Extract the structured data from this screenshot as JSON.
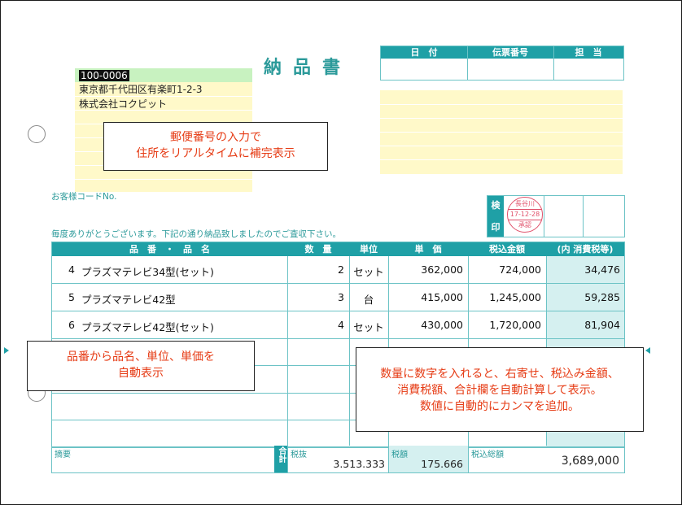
{
  "title": "納品書",
  "header_table": {
    "labels": [
      "日　付",
      "伝票番号",
      "担　当"
    ]
  },
  "address": {
    "postal": "100-0006",
    "line1": "東京都千代田区有楽町1-2-3",
    "line2": "株式会社コクピット"
  },
  "callouts": {
    "address_note": [
      "郵便番号の入力で",
      "住所をリアルタイムに補完表示"
    ],
    "product_note": [
      "品番から品名、単位、単価を",
      "自動表示"
    ],
    "calc_note": [
      "数量に数字を入れると、右寄せ、税込み金額、",
      "消費税額、合計欄を自動計算して表示。",
      "数値に自動的にカンマを追加。"
    ]
  },
  "customer_code_label": "お客様コードNo.",
  "thanks_text": "毎度ありがとうございます。下記の通り納品致しましたのでご査収下さい。",
  "inspection": {
    "label_top": "検",
    "label_bottom": "印",
    "stamp_name": "長谷川",
    "stamp_date": "17-12-28",
    "stamp_note": "承認"
  },
  "table": {
    "headers": [
      "品　番　・　品　名",
      "数　量",
      "単位",
      "単　価",
      "税込金額",
      "(内 消費税等)"
    ],
    "rows": [
      {
        "no": "4",
        "name": "プラズマテレビ34型(セット)",
        "qty": "2",
        "unit": "セット",
        "price": "362,000",
        "total": "724,000",
        "tax": "34,476"
      },
      {
        "no": "5",
        "name": "プラズマテレビ42型",
        "qty": "3",
        "unit": "台",
        "price": "415,000",
        "total": "1,245,000",
        "tax": "59,285"
      },
      {
        "no": "6",
        "name": "プラズマテレビ42型(セット)",
        "qty": "4",
        "unit": "セット",
        "price": "430,000",
        "total": "1,720,000",
        "tax": "81,904"
      }
    ]
  },
  "footer": {
    "memo_label": "摘要",
    "sum_label": "合計",
    "pretax_label": "税抜",
    "pretax_value": "3.513.333",
    "tax_label": "税額",
    "tax_value": "175.666",
    "grand_label": "税込総額",
    "grand_value": "3,689,000"
  },
  "colors": {
    "accent": "#1fa0a6",
    "light_accent": "#d5f0f0",
    "highlight": "#fff9c9",
    "callout_text": "#e63b14"
  }
}
